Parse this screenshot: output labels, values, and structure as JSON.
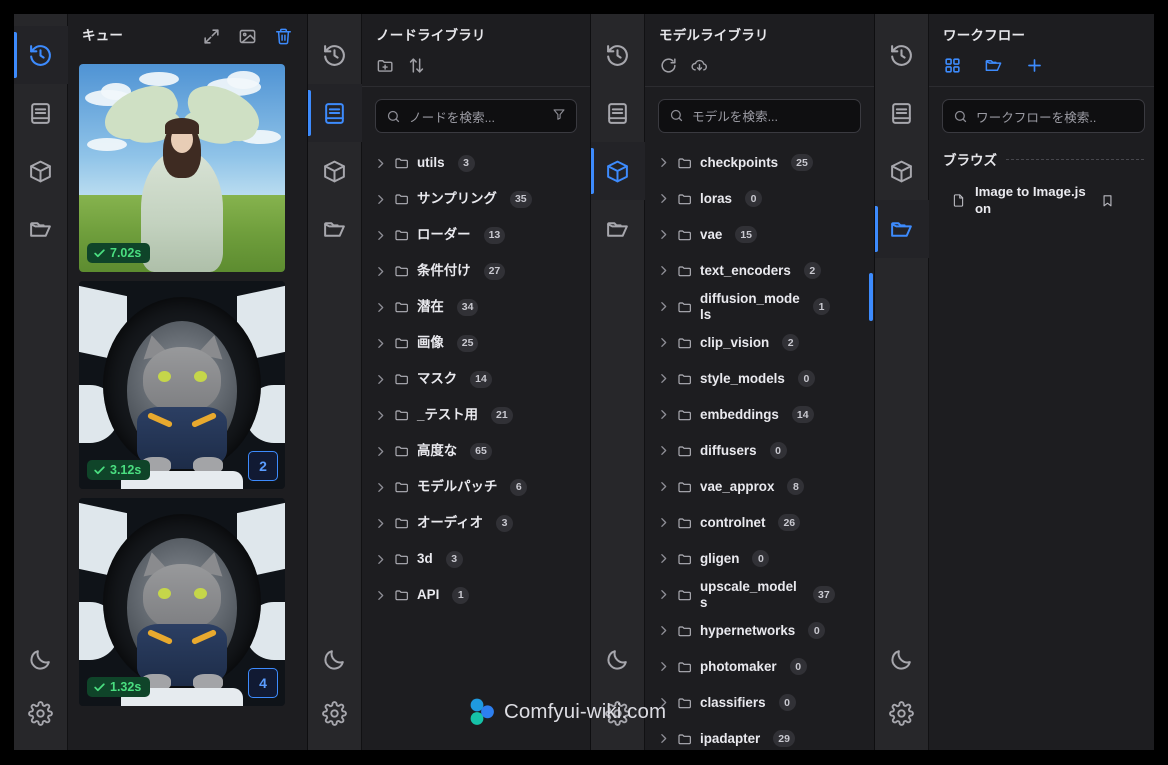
{
  "app": {
    "watermark": "Comfyui-wiki.com"
  },
  "queue_panel": {
    "title": "キュー",
    "actions": [
      {
        "name": "expand-icon",
        "label": "expand-icon"
      },
      {
        "name": "image-icon",
        "label": "image-icon"
      },
      {
        "name": "trash-icon",
        "label": "trash-icon"
      }
    ],
    "items": [
      {
        "time": "7.02s",
        "count": "",
        "art": "angel"
      },
      {
        "time": "3.12s",
        "count": "2",
        "art": "cat"
      },
      {
        "time": "1.32s",
        "count": "4",
        "art": "cat"
      }
    ]
  },
  "node_panel": {
    "title": "ノードライブラリ",
    "actions": [
      {
        "name": "new-folder-icon"
      },
      {
        "name": "sort-icon"
      }
    ],
    "search_placeholder": "ノードを検索...",
    "items": [
      {
        "label": "utils",
        "count": "3"
      },
      {
        "label": "サンプリング",
        "count": "35"
      },
      {
        "label": "ローダー",
        "count": "13"
      },
      {
        "label": "条件付け",
        "count": "27"
      },
      {
        "label": "潜在",
        "count": "34"
      },
      {
        "label": "画像",
        "count": "25"
      },
      {
        "label": "マスク",
        "count": "14"
      },
      {
        "label": "_テスト用",
        "count": "21"
      },
      {
        "label": "高度な",
        "count": "65"
      },
      {
        "label": "モデルパッチ",
        "count": "6"
      },
      {
        "label": "オーディオ",
        "count": "3"
      },
      {
        "label": "3d",
        "count": "3"
      },
      {
        "label": "API",
        "count": "1"
      }
    ]
  },
  "model_panel": {
    "title": "モデルライブラリ",
    "actions": [
      {
        "name": "refresh-icon"
      },
      {
        "name": "cloud-download-icon"
      }
    ],
    "search_placeholder": "モデルを検索...",
    "items": [
      {
        "label": "checkpoints",
        "count": "25"
      },
      {
        "label": "loras",
        "count": "0"
      },
      {
        "label": "vae",
        "count": "15"
      },
      {
        "label": "text_encoders",
        "count": "2"
      },
      {
        "label": "diffusion_models",
        "count": "1"
      },
      {
        "label": "clip_vision",
        "count": "2"
      },
      {
        "label": "style_models",
        "count": "0"
      },
      {
        "label": "embeddings",
        "count": "14"
      },
      {
        "label": "diffusers",
        "count": "0"
      },
      {
        "label": "vae_approx",
        "count": "8"
      },
      {
        "label": "controlnet",
        "count": "26"
      },
      {
        "label": "gligen",
        "count": "0"
      },
      {
        "label": "upscale_models",
        "count": "37"
      },
      {
        "label": "hypernetworks",
        "count": "0"
      },
      {
        "label": "photomaker",
        "count": "0"
      },
      {
        "label": "classifiers",
        "count": "0"
      },
      {
        "label": "ipadapter",
        "count": "29"
      }
    ]
  },
  "workflow_panel": {
    "title": "ワークフロー",
    "actions": [
      {
        "name": "grid-icon"
      },
      {
        "name": "open-folder-icon"
      },
      {
        "name": "plus-icon"
      }
    ],
    "search_placeholder": "ワークフローを検索..",
    "browse_label": "ブラウズ",
    "items": [
      {
        "name": "Image to Image.json"
      }
    ]
  },
  "rails": {
    "items": [
      {
        "name": "queue-history-icon",
        "active_in": "queue"
      },
      {
        "name": "node-library-icon",
        "active_in": "node"
      },
      {
        "name": "model-library-icon",
        "active_in": "model"
      },
      {
        "name": "workflows-icon",
        "active_in": "flow"
      }
    ],
    "bottom": [
      {
        "name": "theme-moon-icon"
      },
      {
        "name": "settings-gear-icon"
      }
    ]
  },
  "colors": {
    "accent": "#3d8bfd",
    "success": "#4ade80",
    "panel_bg": "#1d1d20",
    "rail_bg": "#27272a"
  }
}
